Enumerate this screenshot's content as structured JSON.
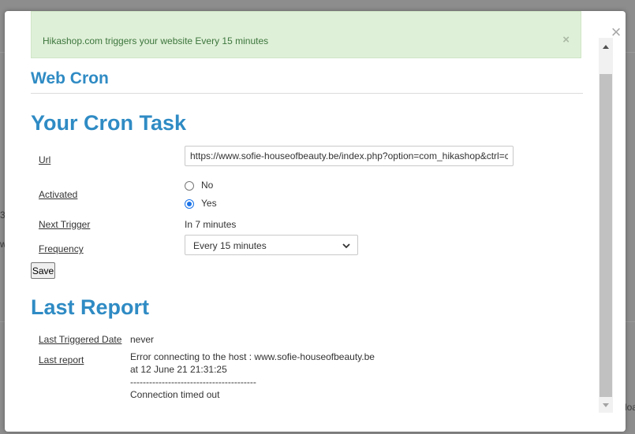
{
  "colors": {
    "accent": "#2f8bc4",
    "alert_bg": "#dff0d8",
    "alert_text": "#3c763d",
    "radio_checked": "#1a73e8"
  },
  "alert": {
    "message": "Hikashop.com triggers your website Every 15 minutes",
    "close_symbol": "×"
  },
  "modal": {
    "close_symbol": "×"
  },
  "section_title": "Web Cron",
  "cron_task": {
    "heading": "Your Cron Task",
    "url_label": "Url",
    "url_value": "https://www.sofie-houseofbeauty.be/index.php?option=com_hikashop&ctrl=cron",
    "activated_label": "Activated",
    "options": [
      {
        "label": "No",
        "checked": false
      },
      {
        "label": "Yes",
        "checked": true
      }
    ],
    "next_trigger_label": "Next Trigger",
    "next_trigger_value": "In 7 minutes",
    "frequency_label": "Frequency",
    "frequency_value": "Every 15 minutes",
    "save_label": "Save"
  },
  "last_report": {
    "heading": "Last Report",
    "triggered_label": "Last Triggered Date",
    "triggered_value": "never",
    "report_label": "Last report",
    "report_line1": "Error connecting to the host : www.sofie-houseofbeauty.be",
    "report_line2": "at 12 June 21 21:31:25",
    "report_separator": "----------------------------------------",
    "report_line3": "Connection timed out"
  },
  "background": {
    "fragment_left_1": "3",
    "fragment_left_2": "w",
    "fragment_right": "loa"
  }
}
